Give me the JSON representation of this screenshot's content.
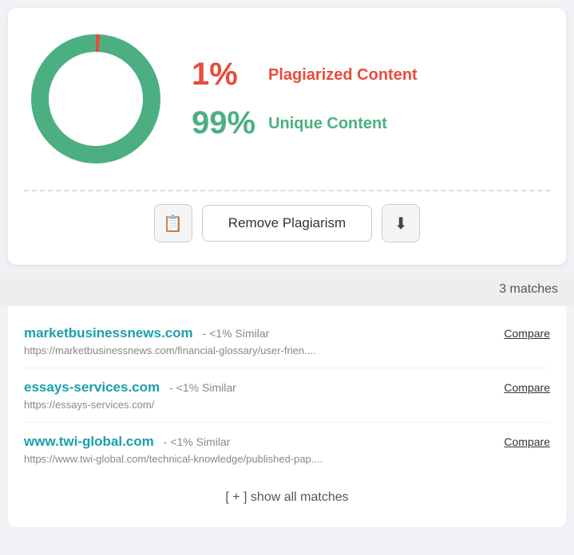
{
  "donut": {
    "plagiarized_pct": 1,
    "unique_pct": 99,
    "plagiarized_color": "#e74c3c",
    "unique_color": "#4caf82",
    "track_color": "#4caf82",
    "indicator_color": "#e74c3c"
  },
  "stats": {
    "plagiarized_value": "1%",
    "plagiarized_label": "Plagiarized Content",
    "unique_value": "99%",
    "unique_label": "Unique Content"
  },
  "actions": {
    "report_icon": "📋",
    "download_icon": "⬇",
    "remove_label": "Remove Plagiarism"
  },
  "matches": {
    "count_label": "3 matches"
  },
  "results": [
    {
      "domain": "marketbusinessnews.com",
      "similarity": "- <1% Similar",
      "url": "https://marketbusinessnews.com/financial-glossary/user-frien....",
      "compare_label": "Compare"
    },
    {
      "domain": "essays-services.com",
      "similarity": "- <1% Similar",
      "url": "https://essays-services.com/",
      "compare_label": "Compare"
    },
    {
      "domain": "www.twi-global.com",
      "similarity": "- <1% Similar",
      "url": "https://www.twi-global.com/technical-knowledge/published-pap....",
      "compare_label": "Compare"
    }
  ],
  "show_all": {
    "label": "[ + ] show all matches"
  }
}
